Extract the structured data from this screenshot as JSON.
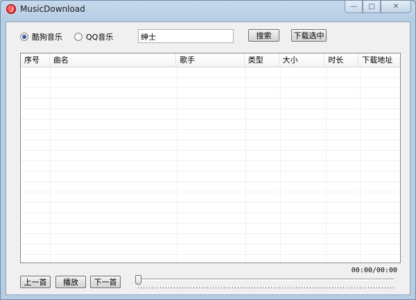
{
  "window": {
    "title": "MusicDownload",
    "controls": {
      "minimize": "—",
      "maximize": "□",
      "close": "✕"
    }
  },
  "sources": [
    {
      "label": "酷狗音乐",
      "checked": true
    },
    {
      "label": "QQ音乐",
      "checked": false
    }
  ],
  "search": {
    "value": "绅士",
    "search_label": "搜索",
    "download_selected_label": "下载选中"
  },
  "table": {
    "columns": [
      "序号",
      "曲名",
      "歌手",
      "类型",
      "大小",
      "时长",
      "下载地址"
    ],
    "rows": []
  },
  "player": {
    "prev_label": "上一首",
    "play_label": "播放",
    "next_label": "下一首",
    "time": "00:00/00:00",
    "progress": 0
  },
  "colors": {
    "accent": "#1c3f80",
    "app_icon": "#d21414"
  }
}
